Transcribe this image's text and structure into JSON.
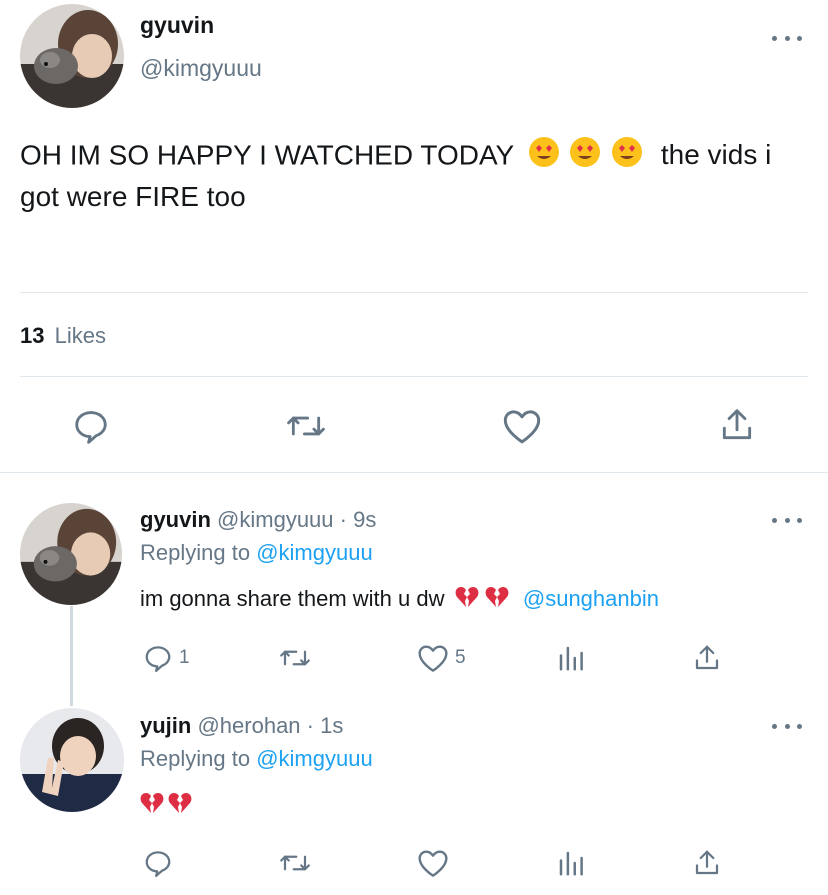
{
  "main_tweet": {
    "author_name": "gyuvin",
    "author_handle": "@kimgyuuu",
    "text": "OH IM SO HAPPY I WATCHED TODAY",
    "emojis": [
      "heart-eyes-emoji",
      "heart-eyes-emoji",
      "heart-eyes-emoji"
    ],
    "text_after_emojis": "the vids i",
    "text_line2": "got were FIRE too",
    "likes_count": "13",
    "likes_label": "Likes"
  },
  "replies": [
    {
      "author_name": "gyuvin",
      "author_handle": "@kimgyuuu",
      "time": "· 9s",
      "replying_label": "Replying to",
      "replying_handle": "@kimgyuuu",
      "text": "im gonna share them with u dw",
      "emojis": [
        "broken-heart-emoji",
        "broken-heart-emoji"
      ],
      "mention": "@sunghanbin",
      "reply_count": "1",
      "like_count": "5"
    },
    {
      "author_name": "yujin",
      "author_handle": "@herohan",
      "time": "· 1s",
      "replying_label": "Replying to",
      "replying_handle": "@kimgyuuu",
      "emojis": [
        "broken-heart-emoji",
        "broken-heart-emoji"
      ]
    }
  ],
  "colors": {
    "link": "#1da1f2",
    "muted": "#657786",
    "text": "#14171a",
    "divider": "#e1e8ed"
  },
  "icons": [
    "reply-icon",
    "retweet-icon",
    "like-icon",
    "share-icon",
    "analytics-icon",
    "more-options-icon"
  ]
}
